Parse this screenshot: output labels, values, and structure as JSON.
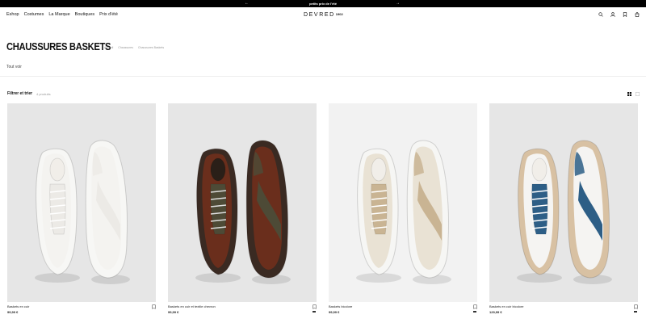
{
  "promo": {
    "text": "petits prix de l'été",
    "prev": "←",
    "next": "→"
  },
  "nav": [
    "Eshop",
    "Costumes",
    "La Marque",
    "Boutiques",
    "Prix d'été"
  ],
  "logo": {
    "main": "DEVRED",
    "sub": "1902"
  },
  "header_icons": [
    "search-icon",
    "account-icon",
    "wishlist-icon",
    "bag-icon"
  ],
  "page": {
    "title": "CHAUSSURES BASKETS",
    "breadcrumbs": [
      "Accueil",
      "Chaussures",
      "Chaussures Baskets"
    ],
    "tout_voir": "Tout voir"
  },
  "toolbar": {
    "filter_label": "Filtrer et trier",
    "count": "4 produits"
  },
  "products": [
    {
      "name": "Baskets en cuir",
      "price": "99,99 €",
      "colors": {
        "upper": "#f4f3f0",
        "accent": "#eceae6",
        "sole": "#f7f7f5"
      }
    },
    {
      "name": "Baskets en cuir et textile chevron",
      "price": "99,99 €",
      "colors": {
        "upper": "#6a2e1c",
        "accent": "#4d4a36",
        "sole": "#3a2a22"
      }
    },
    {
      "name": "Baskets bicolore",
      "price": "99,99 €",
      "colors": {
        "upper": "#e9e2d4",
        "accent": "#c9b493",
        "sole": "#f6f6f4"
      }
    },
    {
      "name": "Baskets en cuir bicolore",
      "price": "129,99 €",
      "colors": {
        "upper": "#f5f4f2",
        "accent": "#2d5e86",
        "sole": "#d8c1a3"
      }
    }
  ]
}
